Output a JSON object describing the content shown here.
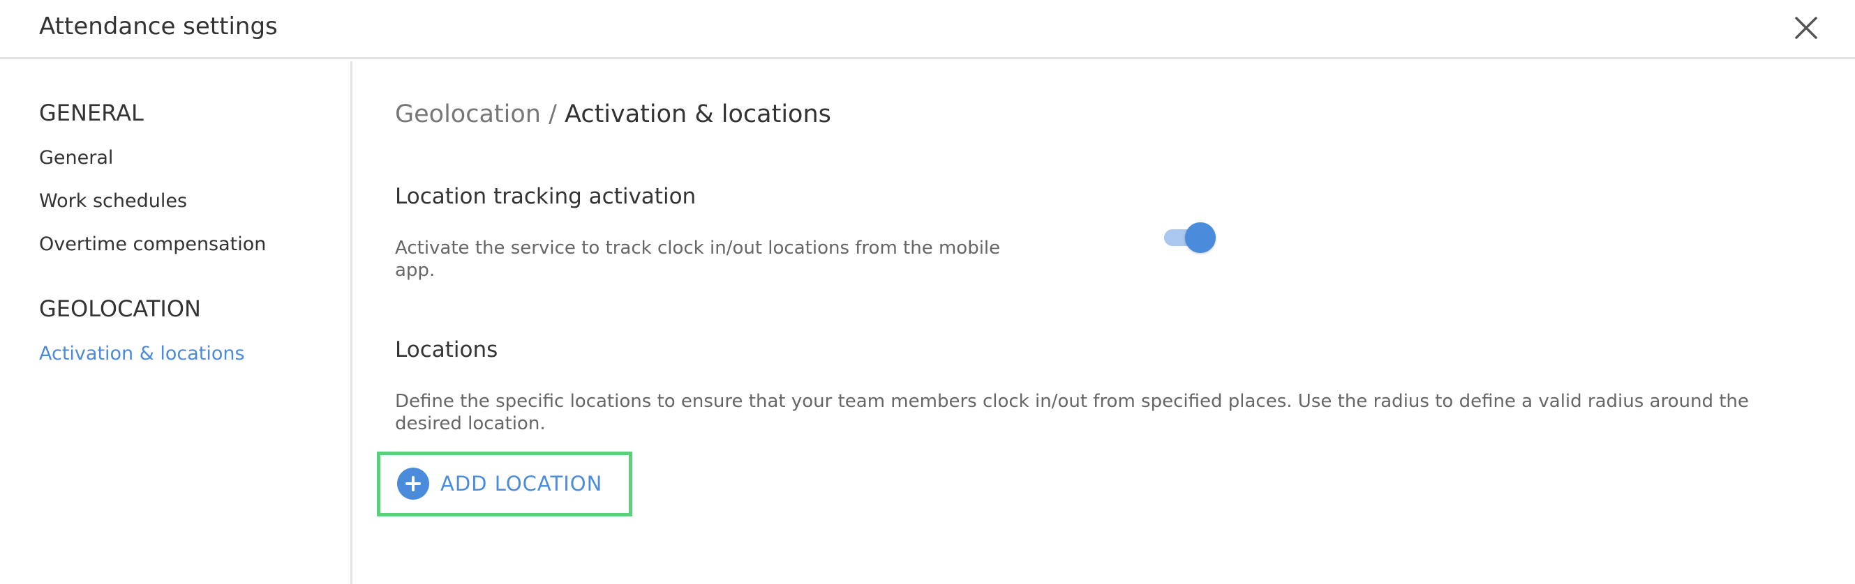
{
  "header": {
    "title": "Attendance settings",
    "close_icon": "close-icon"
  },
  "sidebar": {
    "sections": [
      {
        "heading": "GENERAL",
        "items": [
          {
            "label": "General",
            "active": false
          },
          {
            "label": "Work schedules",
            "active": false
          },
          {
            "label": "Overtime compensation",
            "active": false
          }
        ]
      },
      {
        "heading": "GEOLOCATION",
        "items": [
          {
            "label": "Activation & locations",
            "active": true
          }
        ]
      }
    ]
  },
  "main": {
    "breadcrumb": {
      "parent": "Geolocation /",
      "current": "Activation & locations"
    },
    "tracking": {
      "title": "Location tracking activation",
      "description": "Activate the service to track clock in/out locations from the mobile app.",
      "toggle_on": true
    },
    "locations": {
      "title": "Locations",
      "description": "Define the specific locations to ensure that your team members clock in/out from specified places. Use the radius to define a valid radius around the desired location.",
      "add_button_label": "ADD LOCATION",
      "add_icon": "plus-circle-icon"
    }
  },
  "colors": {
    "accent": "#4a8bdc",
    "highlight_border": "#5bd07a",
    "divider": "#e3e3e3"
  }
}
